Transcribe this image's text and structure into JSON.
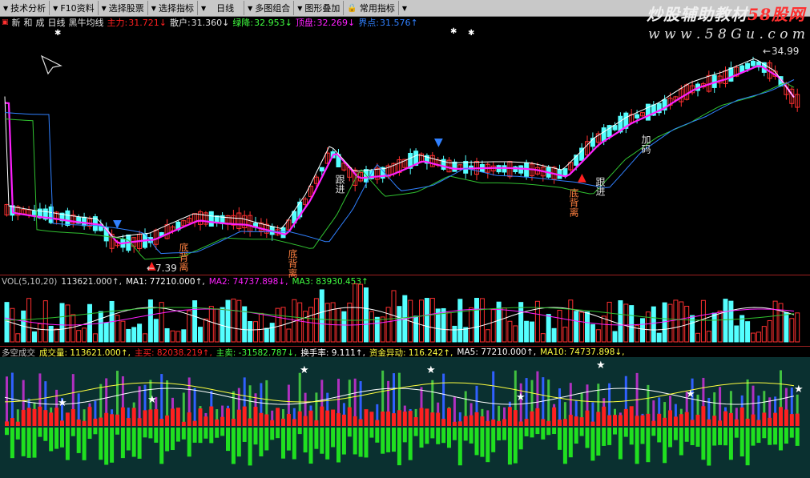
{
  "toolbar": {
    "items": [
      "技术分析",
      "F10资料",
      "选择股票",
      "选择指标",
      "日线",
      "多图组合",
      "图形叠加",
      "常用指标"
    ]
  },
  "watermark": {
    "title_a": "炒股辅助教材",
    "title_b": "58股网",
    "url": "w w w . 5 8 G u . c o m"
  },
  "indicator_bar": {
    "tabs": [
      "新",
      "和",
      "成"
    ],
    "period": "日线",
    "name": "黑牛均线",
    "main_label": "主力:",
    "main_val": "31.721↓",
    "retail_label": "散户:",
    "retail_val": "31.360↓",
    "green_label": "绿降:",
    "green_val": "32.953↓",
    "red_label": "顶盘:",
    "red_val": "32.269↓",
    "point_label": "界点:",
    "point_val": "31.576↑"
  },
  "volume_legend": {
    "name": "VOL(5,10,20)",
    "vol": "113621.000↑,",
    "ma1": "MA1: 77210.000↑,",
    "ma2": "MA2: 74737.898↓,",
    "ma3": "MA3: 83930.453↑"
  },
  "duokong_legend": {
    "name": "多空成交",
    "vol": "成交量: 113621.000↑,",
    "buy": "主买: 82038.219↑,",
    "sell": "主卖: -31582.787↓,",
    "turnover": "换手率: 9.111↑,",
    "flow": "资金异动: 116.242↑,",
    "ma5": "MA5: 77210.000↑,",
    "ma10": "MA10: 74737.898↓,"
  },
  "chart_labels": {
    "high_price": "34.99",
    "low_price": "7.39",
    "low_arrow": "←",
    "high_arrow": "←",
    "annotations": [
      "底背离",
      "底背离",
      "跟进",
      "底背离",
      "跟进",
      "加码"
    ]
  },
  "colors": {
    "up": "#ff3030",
    "down": "#54ffff",
    "ma_magenta": "#ff20ff",
    "ma_white": "#ffffff",
    "ma_green": "#30c030",
    "ma_blue": "#3080ff",
    "main_red": "#ff2020",
    "green_text": "#40ff40",
    "orange_text": "#ff8040",
    "yellow_text": "#ffff40"
  }
}
